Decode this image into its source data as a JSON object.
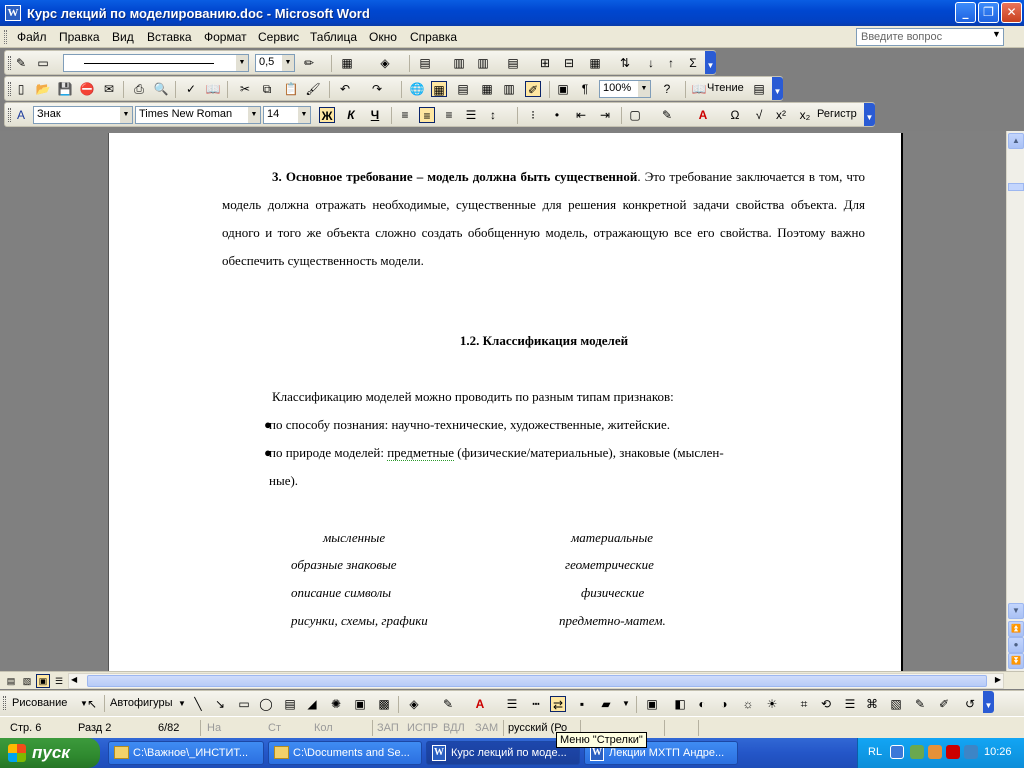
{
  "window": {
    "title": "Курс лекций по моделированию.doc - Microsoft Word",
    "app_icon": "W",
    "buttons": {
      "minimize": "_",
      "maximize": "❐",
      "close": "✕"
    }
  },
  "menu": {
    "items": [
      "Файл",
      "Правка",
      "Вид",
      "Вставка",
      "Формат",
      "Сервис",
      "Таблица",
      "Окно",
      "Справка"
    ],
    "help_placeholder": "Введите вопрос"
  },
  "toolbar_tables": {
    "line_weight": "0,5"
  },
  "toolbar_standard": {
    "zoom": "100%",
    "reading_label": "Чтение"
  },
  "toolbar_format": {
    "style": "Знак",
    "font": "Times New Roman",
    "size": "14",
    "bold": "Ж",
    "italic": "К",
    "underline": "Ч",
    "register_label": "Регистр"
  },
  "document": {
    "para1_bold": "3. Основное требование – модель должна быть существенной",
    "para1_rest": ". Это требование заключается в том, что модель должна отражать необходимые, существенные для решения конкретной задачи свойства объекта. Для одного и того же объекта сложно создать обобщенную модель, отражающую все  его свойства. Поэтому важно обеспечить существенность модели.",
    "heading": "1.2. Классификация моделей",
    "intro": "Классификацию моделей можно проводить по разным типам признаков:",
    "bullet1": "по способу познания: научно-технические, художественные, житейские.",
    "bullet2_a": "по природе моделей: ",
    "bullet2_link": "предметные",
    "bullet2_b": " (физические/материальные), знаковые (мыслен-",
    "bullet2_c": "ные).",
    "left_col": [
      "мысленные",
      "образные   знаковые",
      "описание   символы",
      "рисунки, схемы, графики"
    ],
    "right_col": [
      "материальные",
      "геометрические",
      "физические",
      "предметно-матем."
    ]
  },
  "drawing_toolbar": {
    "drawing_label": "Рисование",
    "autoshapes_label": "Автофигуры"
  },
  "status": {
    "page": "Стр.  6",
    "section": "Разд  2",
    "pages": "6/82",
    "at": "На",
    "line": "Ст",
    "col": "Кол",
    "rec": "ЗАП",
    "trk": "ИСПР",
    "ext": "ВДЛ",
    "ovr": "ЗАМ",
    "lang": "русский (Ро",
    "tooltip": "Меню \"Стрелки\""
  },
  "taskbar": {
    "start": "пуск",
    "tasks": [
      "C:\\Важное\\_ИНСТИТ...",
      "C:\\Documents and Se...",
      "Курс лекций по моде...",
      "Лекции МХТП Андре..."
    ],
    "lang": "RL",
    "clock": "10:26"
  },
  "colors": {
    "titlebar": "#0047d0",
    "accent_pressed": "#ffe7a2",
    "start_green": "#2f8a2f",
    "spell_underline": "#2a9a2a"
  }
}
